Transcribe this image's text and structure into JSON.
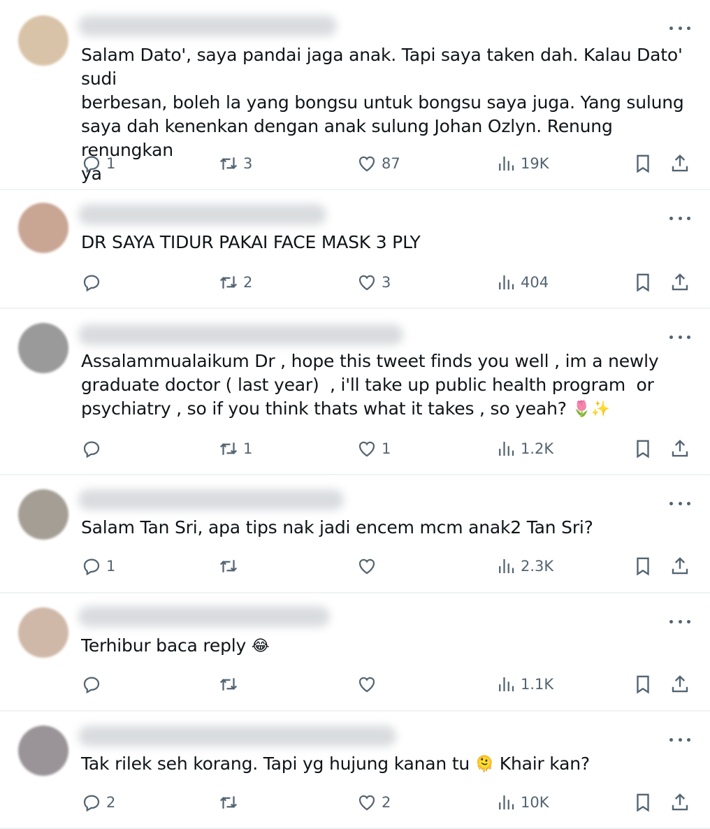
{
  "replies": [
    {
      "text": "Salam Dato', saya pandai jaga anak. Tapi saya taken dah. Kalau Dato' sudi\nberbesan, boleh la yang bongsu untuk bongsu saya juga. Yang sulung\nsaya dah kenenkan dengan anak sulung Johan Ozlyn. Renung renungkan\nya",
      "emoji": "",
      "emoji_after": "",
      "replies": "1",
      "reposts": "3",
      "likes": "87",
      "views": "19K",
      "avatar_color": "#d9c3a8"
    },
    {
      "text": "DR SAYA TIDUR PAKAI FACE MASK 3 PLY",
      "emoji": "",
      "emoji_after": "",
      "replies": "",
      "reposts": "2",
      "likes": "3",
      "views": "404",
      "avatar_color": "#c9a594"
    },
    {
      "text": "Assalammualaikum Dr , hope this tweet finds you well , im a newly\ngraduate doctor ( last year)  , i'll take up public health program  or\npsychiatry , so if you think thats what it takes , so yeah? ",
      "emoji": "🌷✨",
      "emoji_after": "",
      "replies": "",
      "reposts": "1",
      "likes": "1",
      "views": "1.2K",
      "avatar_color": "#9a9a9a"
    },
    {
      "text": "Salam Tan Sri, apa tips nak jadi encem mcm anak2 Tan Sri?",
      "emoji": "",
      "emoji_after": "",
      "replies": "1",
      "reposts": "",
      "likes": "",
      "views": "2.3K",
      "avatar_color": "#a59e94"
    },
    {
      "text": "Terhibur baca reply ",
      "emoji": "😂",
      "emoji_after": "",
      "replies": "",
      "reposts": "",
      "likes": "",
      "views": "1.1K",
      "avatar_color": "#cfb8a8"
    },
    {
      "text": "Tak rilek seh korang. Tapi yg hujung kanan tu ",
      "emoji": "🫠",
      "emoji_after": " Khair kan?",
      "replies": "2",
      "reposts": "",
      "likes": "2",
      "views": "10K",
      "avatar_color": "#9a9499"
    }
  ]
}
